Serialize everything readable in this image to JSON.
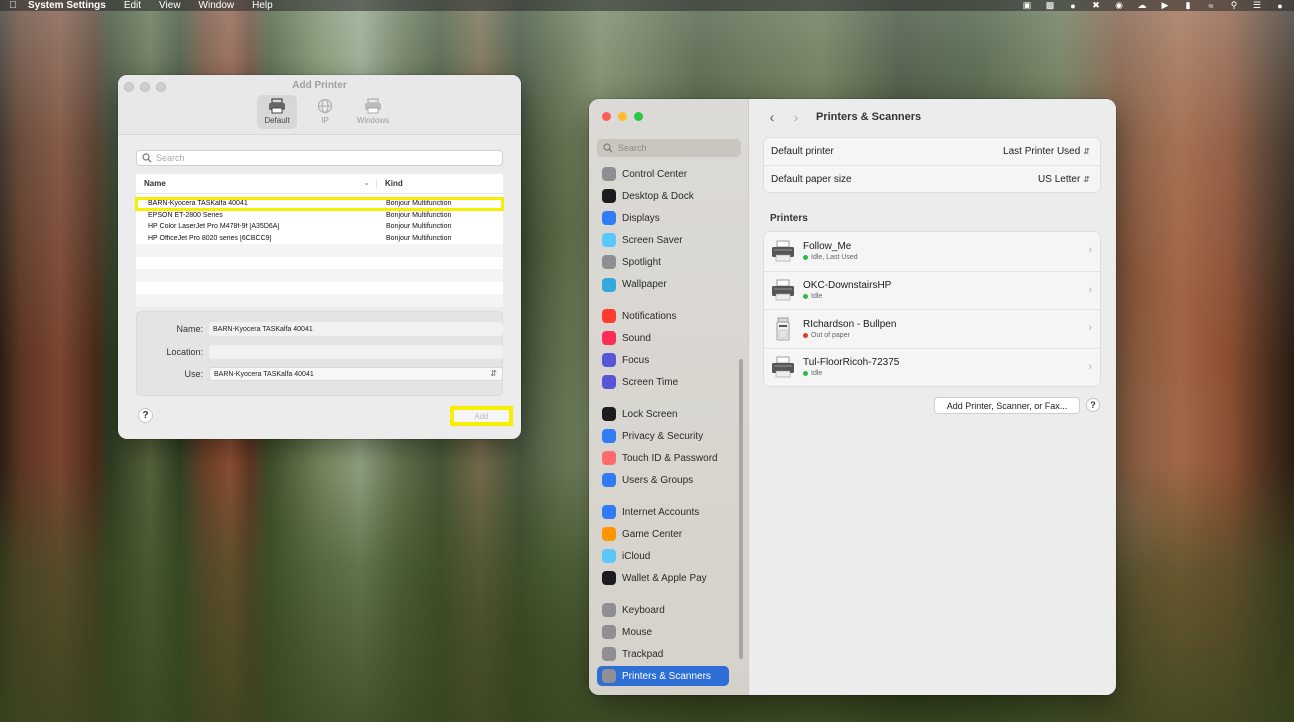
{
  "menubar": {
    "app_name": "System Settings",
    "menus": [
      "Edit",
      "View",
      "Window",
      "Help"
    ]
  },
  "add_printer": {
    "title": "Add Printer",
    "tabs": [
      {
        "label": "Default",
        "icon": "printer-icon",
        "active": true
      },
      {
        "label": "IP",
        "icon": "globe-icon",
        "active": false
      },
      {
        "label": "Windows",
        "icon": "windows-printer-icon",
        "active": false
      }
    ],
    "search_placeholder": "Search",
    "columns": {
      "name": "Name",
      "kind": "Kind"
    },
    "printers": [
      {
        "name": "BARN-Kyocera TASKalfa 40041",
        "kind": "Bonjour Multifunction",
        "selected": true
      },
      {
        "name": "EPSON ET-2800 Series",
        "kind": "Bonjour Multifunction",
        "selected": false
      },
      {
        "name": "HP Color LaserJet Pro M478f-9f [A35D6A]",
        "kind": "Bonjour Multifunction",
        "selected": false
      },
      {
        "name": "HP OfficeJet Pro 8020 series [6CBCC9]",
        "kind": "Bonjour Multifunction",
        "selected": false
      }
    ],
    "form": {
      "name_label": "Name:",
      "name_value": "BARN-Kyocera TASKalfa 40041",
      "location_label": "Location:",
      "location_value": "",
      "use_label": "Use:",
      "use_value": "BARN-Kyocera TASKalfa 40041"
    },
    "help_label": "?",
    "add_label": "Add"
  },
  "settings": {
    "search_placeholder": "Search",
    "sidebar_groups": [
      [
        {
          "label": "Control Center",
          "icon": "control-center-icon",
          "color": "#8e8e93"
        },
        {
          "label": "Desktop & Dock",
          "icon": "desktop-dock-icon",
          "color": "#1c1c1e"
        },
        {
          "label": "Displays",
          "icon": "displays-icon",
          "color": "#2f7cf6"
        },
        {
          "label": "Screen Saver",
          "icon": "screen-saver-icon",
          "color": "#5ac8fa"
        },
        {
          "label": "Spotlight",
          "icon": "spotlight-icon",
          "color": "#8e8e93"
        },
        {
          "label": "Wallpaper",
          "icon": "wallpaper-icon",
          "color": "#34aadc"
        }
      ],
      [
        {
          "label": "Notifications",
          "icon": "notifications-icon",
          "color": "#ff3b30"
        },
        {
          "label": "Sound",
          "icon": "sound-icon",
          "color": "#ff2d55"
        },
        {
          "label": "Focus",
          "icon": "focus-icon",
          "color": "#5856d6"
        },
        {
          "label": "Screen Time",
          "icon": "screen-time-icon",
          "color": "#5856d6"
        }
      ],
      [
        {
          "label": "Lock Screen",
          "icon": "lock-screen-icon",
          "color": "#1c1c1e"
        },
        {
          "label": "Privacy & Security",
          "icon": "privacy-hand-icon",
          "color": "#2f7cf6"
        },
        {
          "label": "Touch ID & Password",
          "icon": "fingerprint-icon",
          "color": "#ff6b6b"
        },
        {
          "label": "Users & Groups",
          "icon": "users-icon",
          "color": "#2f7cf6"
        }
      ],
      [
        {
          "label": "Internet Accounts",
          "icon": "at-sign-icon",
          "color": "#2f7cf6"
        },
        {
          "label": "Game Center",
          "icon": "game-center-icon",
          "color": "#ff9500"
        },
        {
          "label": "iCloud",
          "icon": "icloud-icon",
          "color": "#5ac8fa"
        },
        {
          "label": "Wallet & Apple Pay",
          "icon": "wallet-icon",
          "color": "#1c1c1e"
        }
      ],
      [
        {
          "label": "Keyboard",
          "icon": "keyboard-icon",
          "color": "#8e8e93"
        },
        {
          "label": "Mouse",
          "icon": "mouse-icon",
          "color": "#8e8e93"
        },
        {
          "label": "Trackpad",
          "icon": "trackpad-icon",
          "color": "#8e8e93"
        },
        {
          "label": "Printers & Scanners",
          "icon": "printers-icon",
          "color": "#8e8e93",
          "active": true
        }
      ]
    ],
    "page_title": "Printers & Scanners",
    "default_printer_label": "Default printer",
    "default_printer_value": "Last Printer Used",
    "paper_size_label": "Default paper size",
    "paper_size_value": "US Letter",
    "printers_heading": "Printers",
    "printers": [
      {
        "name": "Follow_Me",
        "status": "Idle, Last Used",
        "status_color": "green",
        "icon": "laser-printer-icon"
      },
      {
        "name": "OKC-DownstairsHP",
        "status": "Idle",
        "status_color": "green",
        "icon": "laser-printer-icon"
      },
      {
        "name": "RIchardson - Bullpen",
        "status": "Out of paper",
        "status_color": "red",
        "icon": "copier-icon"
      },
      {
        "name": "Tul-FloorRicoh-72375",
        "status": "Idle",
        "status_color": "green",
        "icon": "laser-printer-icon"
      }
    ],
    "add_button_label": "Add Printer, Scanner, or Fax...",
    "help_label": "?"
  }
}
